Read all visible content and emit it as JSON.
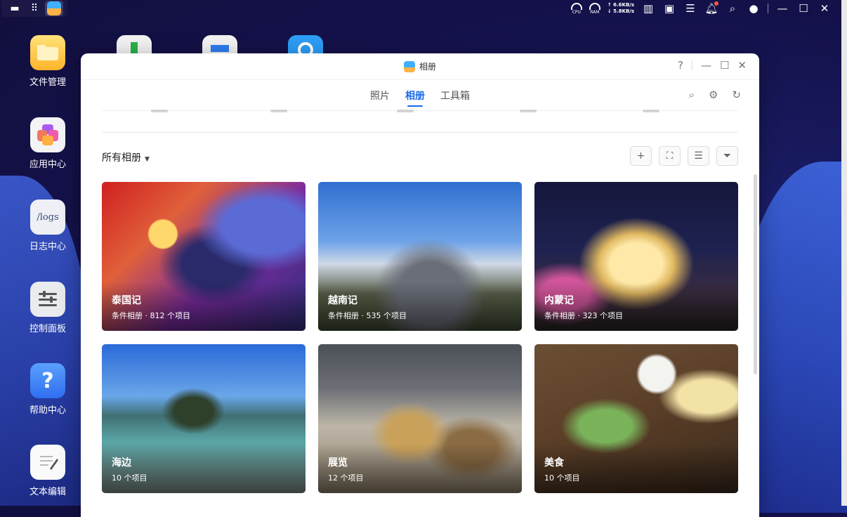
{
  "desktop": {
    "icons": [
      {
        "label": "文件管理"
      },
      {
        "label": "应用中心"
      },
      {
        "label": "日志中心",
        "tile_text": "/logs"
      },
      {
        "label": "控制面板"
      },
      {
        "label": "帮助中心"
      },
      {
        "label": "文本编辑"
      }
    ]
  },
  "topbar": {
    "cpu_label": "CPU",
    "ram_label": "RAM",
    "upload": "↑ 6.6KB/s",
    "download": "↓ 5.8KB/s"
  },
  "window": {
    "title": "相册",
    "help_label": "?",
    "tabs": [
      {
        "label": "照片"
      },
      {
        "label": "相册"
      },
      {
        "label": "工具箱"
      }
    ],
    "section_title": "所有相册",
    "albums": [
      {
        "name": "泰国记",
        "meta": "条件相册 · 812 个项目"
      },
      {
        "name": "越南记",
        "meta": "条件相册 · 535 个项目"
      },
      {
        "name": "内蒙记",
        "meta": "条件相册 · 323 个项目"
      },
      {
        "name": "海边",
        "meta": "10 个项目"
      },
      {
        "name": "展览",
        "meta": "12 个项目"
      },
      {
        "name": "美食",
        "meta": "10 个项目"
      }
    ]
  },
  "colors": {
    "accent": "#1a67e8",
    "desktop_bg": "#14114a"
  }
}
